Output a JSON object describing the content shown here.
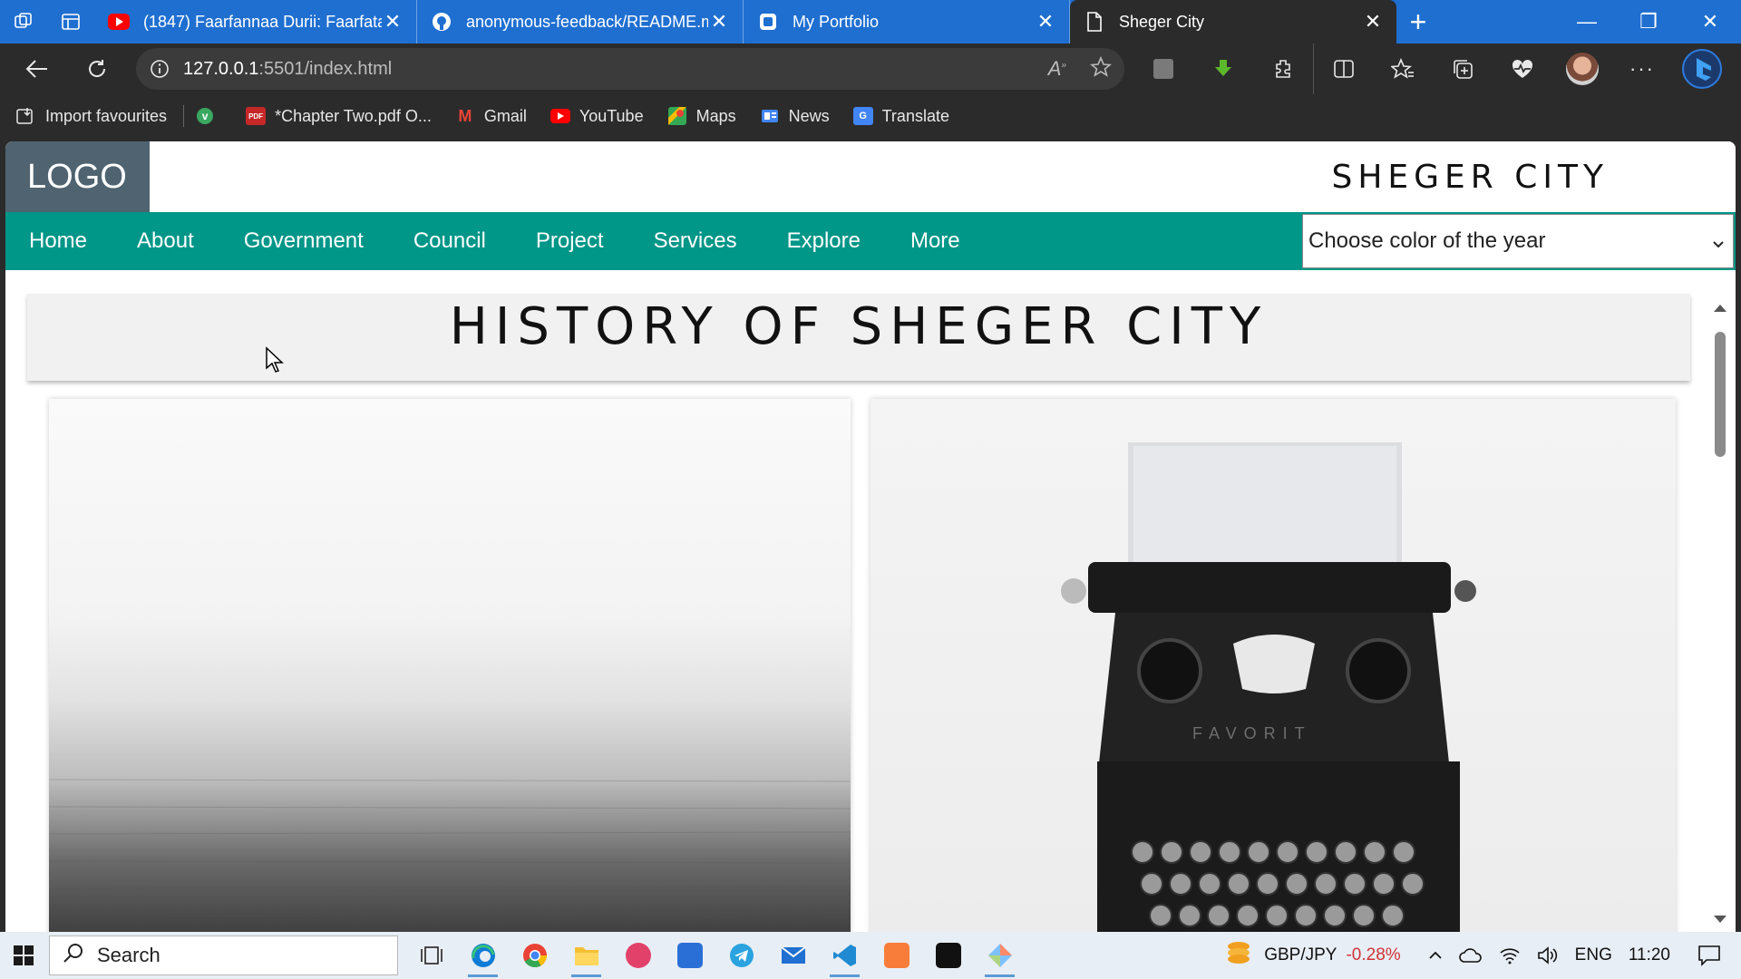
{
  "browser": {
    "tabs": [
      {
        "title": "(1847) Faarfannaa Durii: Faarfata",
        "icon": "youtube-icon"
      },
      {
        "title": "anonymous-feedback/README.m",
        "icon": "github-icon"
      },
      {
        "title": "My Portfolio",
        "icon": "portfolio-icon"
      },
      {
        "title": "Sheger City",
        "icon": "page-icon",
        "active": true
      }
    ],
    "url_host": "127.0.0.1",
    "url_rest": ":5501/index.html",
    "bookmarks": [
      "Import favourites",
      "*Chapter Two.pdf O...",
      "Gmail",
      "YouTube",
      "Maps",
      "News",
      "Translate"
    ]
  },
  "site": {
    "logo": "LOGO",
    "name": "SHEGER CITY",
    "nav": [
      "Home",
      "About",
      "Government",
      "Council",
      "Project",
      "Services",
      "Explore",
      "More"
    ],
    "color_select": "Choose color of the year",
    "history_title": "HISTORY OF SHEGER CITY"
  },
  "taskbar": {
    "search": "Search",
    "ticker_label": "GBP/JPY",
    "ticker_change": "-0.28%",
    "lang": "ENG",
    "time": "11:20"
  },
  "colors": {
    "nav": "#009688",
    "logo_bg": "#4f6470",
    "tabstrip": "#1f6fd1"
  }
}
